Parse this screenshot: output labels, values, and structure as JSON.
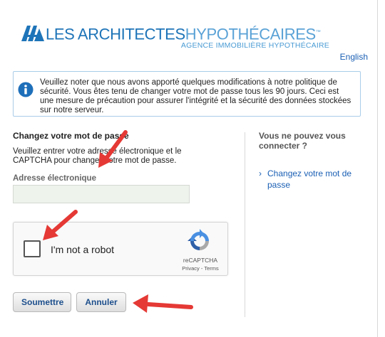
{
  "brand": {
    "name_part1": "LES ARCHITECTES",
    "name_part2": "HYPOTHÉCAIRES",
    "trademark": "™",
    "tagline": "AGENCE IMMOBILIÈRE HYPOTHÉCAIRE"
  },
  "language_link": "English",
  "notice": {
    "text": "Veuillez noter que nous avons apporté quelques modifications à notre politique de sécurité. Vous êtes tenu de changer votre mot de passe tous les 90 jours. Ceci est une mesure de précaution pour assurer l'intégrité et la sécurité des données stockées sur notre serveur."
  },
  "form": {
    "heading": "Changez votre mot de passe",
    "description": "Veuillez entrer votre adresse électronique et le CAPTCHA pour changer votre mot de passe.",
    "email_label": "Adresse électronique",
    "email_value": "",
    "captcha": {
      "checkbox_label": "I'm not a robot",
      "brand": "reCAPTCHA",
      "privacy": "Privacy",
      "separator": " - ",
      "terms": "Terms"
    },
    "submit_label": "Soumettre",
    "cancel_label": "Annuler"
  },
  "sidebar": {
    "heading": "Vous ne pouvez vous connecter ?",
    "link_chevron": "›",
    "link_label": "Changez votre mot de passe"
  },
  "colors": {
    "brand_blue": "#1e74b8",
    "link_blue": "#1a5fb4",
    "annotation_red": "#e53935"
  },
  "icons": [
    "info-icon",
    "recaptcha-logo-icon",
    "chevron-right-icon",
    "annotation-arrow"
  ]
}
